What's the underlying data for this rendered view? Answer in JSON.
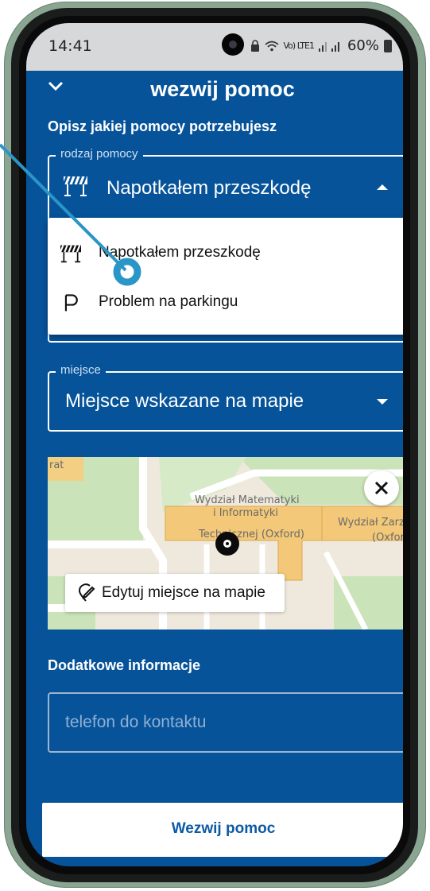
{
  "status_bar": {
    "time": "14:41",
    "network": "Vo) LTE1",
    "battery": "60%"
  },
  "header": {
    "back_icon": "chevron-down-icon",
    "title": "wezwij pomoc"
  },
  "form": {
    "subtitle": "Opisz jakiej pomocy potrzebujesz",
    "help_type": {
      "legend": "rodzaj pomocy",
      "value": "Napotkałem przeszkodę",
      "icon": "barrier-icon",
      "open": true,
      "options": [
        {
          "label": "Napotkałem przeszkodę",
          "icon": "barrier-icon"
        },
        {
          "label": "Problem na parkingu",
          "icon": "parking-icon"
        }
      ]
    },
    "place": {
      "legend": "miejsce",
      "value": "Miejsce wskazane na mapie"
    },
    "map": {
      "labels": [
        "Wydział Matematyki",
        "i Informatyki",
        "Technicznej (Oxford)",
        "Wydział Zarz",
        "(Oxfor",
        "rat"
      ],
      "edit_button": "Edytuj miejsce na mapie"
    },
    "additional_info_title": "Dodatkowe informacje",
    "phone_placeholder": "telefon do kontaktu",
    "submit_label": "Wezwij pomoc"
  },
  "colors": {
    "primary": "#06539a",
    "annotation": "#2a96c8",
    "frame": "#8aa592"
  }
}
